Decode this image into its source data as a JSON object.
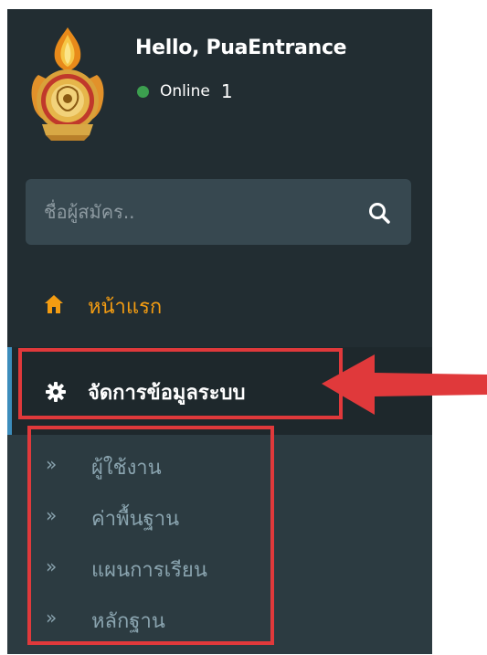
{
  "user_panel": {
    "greeting": "Hello, PuaEntrance",
    "status_label": "Online",
    "online_count": "1",
    "status_color": "#3c9f4f"
  },
  "search": {
    "placeholder": "ชื่อผู้สมัคร.."
  },
  "menu": {
    "home_label": "หน้าแรก",
    "active_label": "จัดการข้อมูลระบบ",
    "submenu": [
      {
        "label": "ผู้ใช้งาน"
      },
      {
        "label": "ค่าพื้นฐาน"
      },
      {
        "label": "แผนการเรียน"
      },
      {
        "label": "หลักฐาน"
      }
    ],
    "submenu_arrow": "»"
  },
  "colors": {
    "sidebar_bg": "#222d32",
    "active_bg": "#1e282c",
    "submenu_bg": "#2c3b41",
    "home_accent": "#f39c12",
    "active_bar": "#3c8dbc",
    "annotation_red": "#e0393b"
  }
}
